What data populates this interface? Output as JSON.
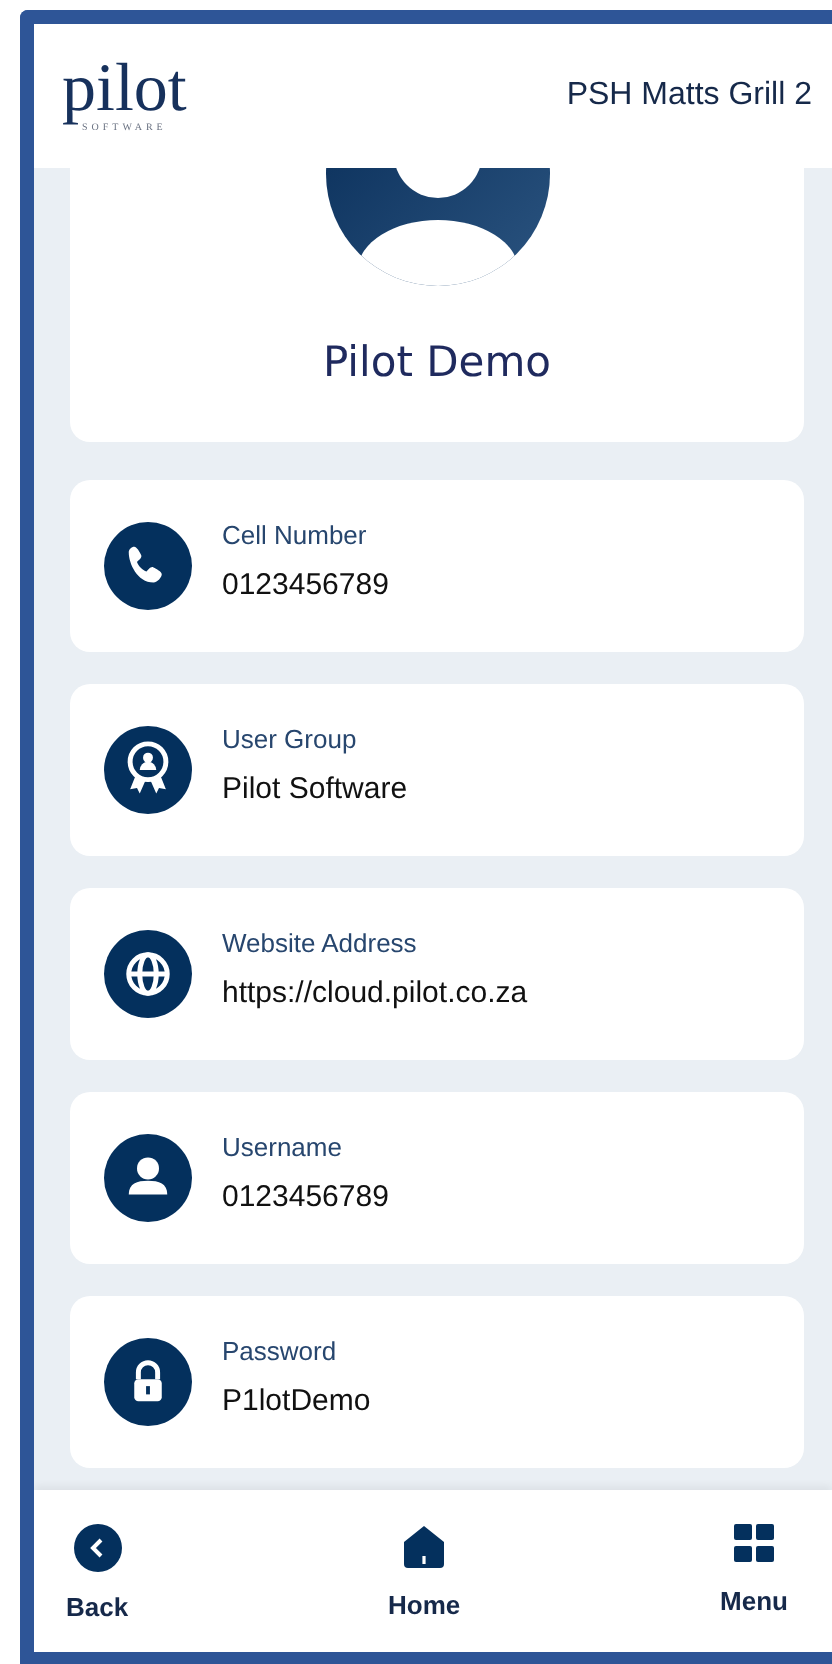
{
  "header": {
    "logo": {
      "wordmark": "pilot",
      "tagline": "SOFTWARE"
    },
    "site": "PSH Matts Grill 2"
  },
  "profile": {
    "name": "Pilot Demo"
  },
  "fields": [
    {
      "kind": "phone",
      "label": "Cell Number",
      "value": "0123456789"
    },
    {
      "kind": "award",
      "label": "User Group",
      "value": "Pilot Software"
    },
    {
      "kind": "globe",
      "label": "Website Address",
      "value": "https://cloud.pilot.co.za"
    },
    {
      "kind": "user",
      "label": "Username",
      "value": "0123456789"
    },
    {
      "kind": "lock",
      "label": "Password",
      "value": "P1lotDemo"
    }
  ],
  "nav": [
    {
      "kind": "back",
      "label": "Back"
    },
    {
      "kind": "home",
      "label": "Home"
    },
    {
      "kind": "menu",
      "label": "Menu"
    }
  ]
}
